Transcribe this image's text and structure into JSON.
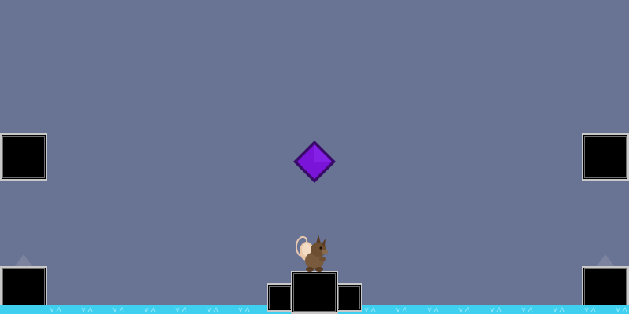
{
  "game": {
    "colors": {
      "sky": "#697394",
      "block_fill": "#000000",
      "block_border": "#c8c8c8",
      "water": "#3fd0f0",
      "water_highlight": "#a8f0ff",
      "gem": "#7a14d8",
      "gem_outline": "#3a0a6a",
      "spike": "#8a90a8"
    },
    "icons": {
      "gem": "purple-diamond-gem-icon",
      "player": "mouse-character-sprite"
    }
  }
}
